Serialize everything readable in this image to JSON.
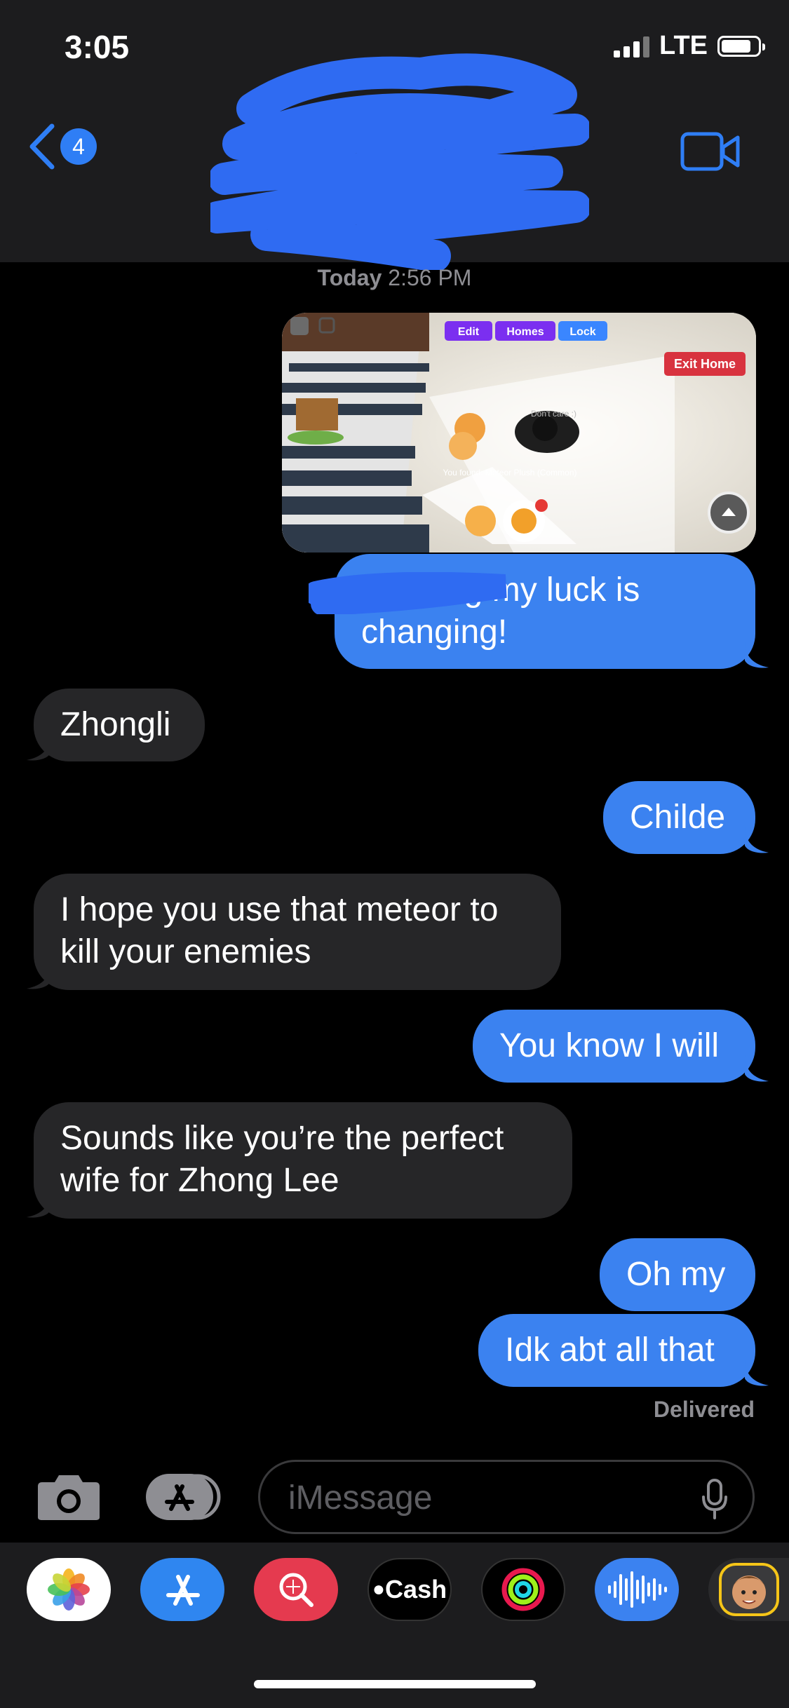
{
  "status": {
    "time": "3:05",
    "network": "LTE"
  },
  "header": {
    "back_count": "4"
  },
  "timestamp": {
    "day": "Today",
    "time": "2:56 PM"
  },
  "image_message": {
    "buttons": [
      "Edit",
      "Homes",
      "Lock"
    ],
    "exit_label": "Exit Home",
    "overlay_text": "You found: Meteor Plush (Common)",
    "sign_text": "Don't care :)"
  },
  "messages": [
    {
      "side": "out",
      "text": "omg my luck is changing!",
      "line1": "omg my luck is",
      "line2": "changing!"
    },
    {
      "side": "in",
      "text": "Zhongli"
    },
    {
      "side": "out",
      "text": "Childe"
    },
    {
      "side": "in",
      "line1": "I hope you use that meteor to",
      "line2": "kill your enemies"
    },
    {
      "side": "out",
      "text": "You know I will"
    },
    {
      "side": "in",
      "line1": "Sounds like you’re the perfect",
      "line2": "wife for Zhong Lee"
    },
    {
      "side": "out",
      "text": "Oh my"
    },
    {
      "side": "out",
      "text": "Idk abt all that"
    }
  ],
  "delivered": "Delivered",
  "input": {
    "placeholder": "iMessage"
  },
  "tray": {
    "cash_label": "Cash"
  },
  "colors": {
    "outgoing": "#3b82f0",
    "incoming": "#262628",
    "accent": "#2f7ef5"
  },
  "icons": [
    "camera-icon",
    "app-store-icon",
    "microphone-icon",
    "video-call-icon",
    "photos-app-icon",
    "search-app-icon",
    "cash-app-icon",
    "activity-app-icon",
    "audio-app-icon",
    "memoji-app-icon"
  ]
}
